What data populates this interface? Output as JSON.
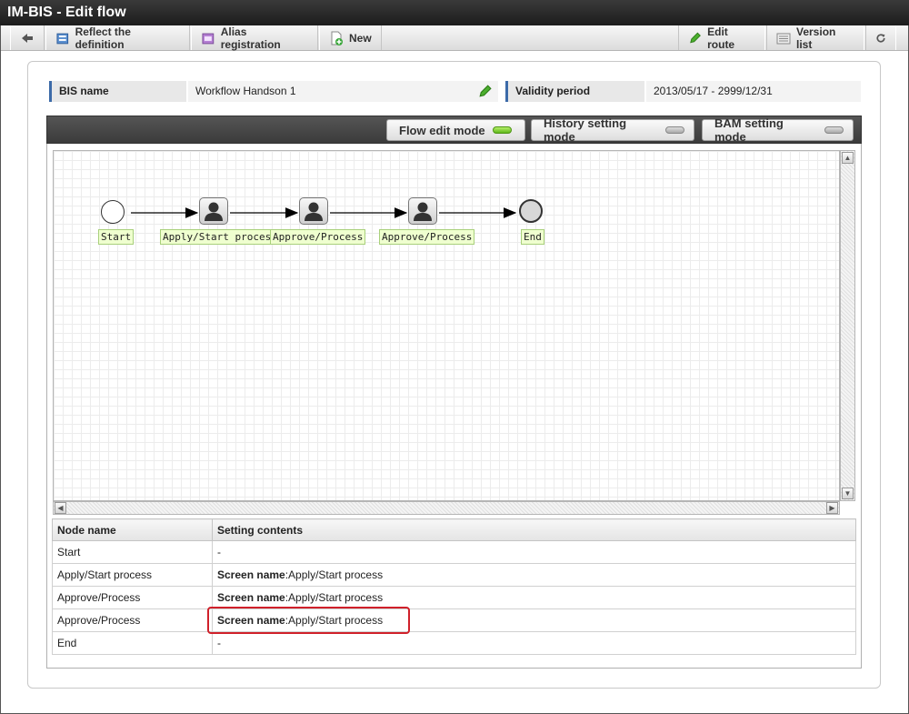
{
  "window": {
    "title": "IM-BIS - Edit flow"
  },
  "toolbar": {
    "back_icon": "arrow-left-icon",
    "reflect_label": "Reflect the definition",
    "alias_label": "Alias registration",
    "new_label": "New",
    "edit_route_label": "Edit route",
    "version_list_label": "Version list",
    "refresh_icon": "refresh-icon"
  },
  "info": {
    "bis_name_label": "BIS name",
    "bis_name_value": "Workflow Handson 1",
    "validity_label": "Validity period",
    "validity_value": "2013/05/17 - 2999/12/31"
  },
  "modes": {
    "flow_edit": "Flow edit mode",
    "history": "History setting mode",
    "bam": "BAM setting mode",
    "active": "flow_edit"
  },
  "flow": {
    "nodes": [
      {
        "label": "Start",
        "type": "start"
      },
      {
        "label": "Apply/Start process",
        "type": "user"
      },
      {
        "label": "Approve/Process",
        "type": "user"
      },
      {
        "label": "Approve/Process",
        "type": "user"
      },
      {
        "label": "End",
        "type": "end"
      }
    ]
  },
  "table": {
    "headers": [
      "Node name",
      "Setting contents"
    ],
    "screen_name_label": "Screen name",
    "rows": [
      {
        "node": "Start",
        "setting": "-"
      },
      {
        "node": "Apply/Start process",
        "setting": ":Apply/Start process",
        "has_screen_name": true
      },
      {
        "node": "Approve/Process",
        "setting": ":Apply/Start process",
        "has_screen_name": true
      },
      {
        "node": "Approve/Process",
        "setting": ":Apply/Start process",
        "has_screen_name": true
      },
      {
        "node": "End",
        "setting": "-"
      }
    ]
  },
  "colors": {
    "active_led": "#5fb81b",
    "highlight": "#d0202a",
    "label_accent": "#3c6aa8"
  }
}
